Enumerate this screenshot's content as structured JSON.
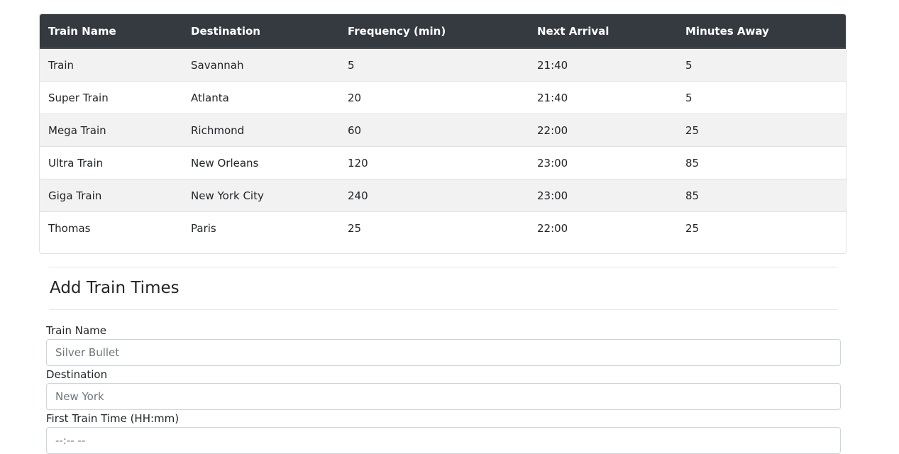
{
  "table": {
    "headers": [
      "Train Name",
      "Destination",
      "Frequency (min)",
      "Next Arrival",
      "Minutes Away"
    ],
    "rows": [
      [
        "Train",
        "Savannah",
        "5",
        "21:40",
        "5"
      ],
      [
        "Super Train",
        "Atlanta",
        "20",
        "21:40",
        "5"
      ],
      [
        "Mega Train",
        "Richmond",
        "60",
        "22:00",
        "25"
      ],
      [
        "Ultra Train",
        "New Orleans",
        "120",
        "23:00",
        "85"
      ],
      [
        "Giga Train",
        "New York City",
        "240",
        "23:00",
        "85"
      ],
      [
        "Thomas",
        "Paris",
        "25",
        "22:00",
        "25"
      ]
    ]
  },
  "form": {
    "title": "Add Train Times",
    "train_name": {
      "label": "Train Name",
      "placeholder": "Silver Bullet",
      "value": ""
    },
    "destination": {
      "label": "Destination",
      "placeholder": "New York",
      "value": ""
    },
    "first_train_time": {
      "label": "First Train Time (HH:mm)",
      "display": "--:-- --"
    }
  },
  "colors": {
    "header_bg": "#343a40",
    "stripe_bg": "#f2f2f2",
    "border": "#dee2e6"
  }
}
